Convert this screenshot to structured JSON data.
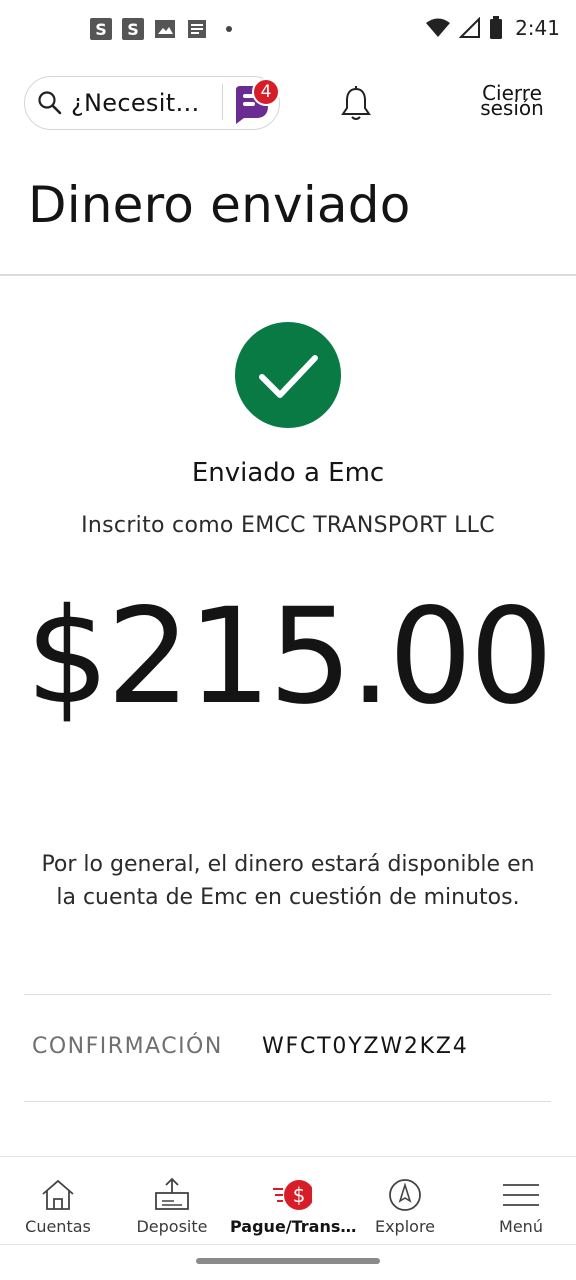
{
  "status_bar": {
    "notif_icon_1": "S",
    "notif_icon_2": "S",
    "time": "2:41",
    "icons": [
      "image-icon",
      "note-icon",
      "wifi-icon",
      "signal-icon",
      "battery-icon"
    ]
  },
  "header": {
    "search_placeholder": "¿Necesit…",
    "fargo_badge_count": "4",
    "logout_line1": "Cierre",
    "logout_line2": "sesión"
  },
  "page": {
    "title": "Dinero enviado"
  },
  "confirmation": {
    "sent_to": "Enviado a Emc",
    "enrolled_as": "Inscrito como EMCC TRANSPORT LLC",
    "amount": "$215.00",
    "info_text": "Por lo general, el dinero estará disponible en la cuenta de Emc en cuestión de minutos.",
    "confirmation_label": "CONFIRMACIÓN",
    "confirmation_number": "WFCT0YZW2KZ4"
  },
  "bottom_nav": {
    "items": [
      {
        "label": "Cuentas",
        "icon": "home-icon"
      },
      {
        "label": "Deposite",
        "icon": "deposit-icon"
      },
      {
        "label": "Pague/Trans…",
        "icon": "pay-transfer-icon"
      },
      {
        "label": "Explore",
        "icon": "compass-icon"
      },
      {
        "label": "Menú",
        "icon": "hamburger-menu-icon"
      }
    ],
    "active_index": 2
  },
  "colors": {
    "success_green": "#0a7a45",
    "brand_red": "#d71e28",
    "fargo_purple": "#6b2c91",
    "text_dark": "#141414",
    "divider": "#dcdcdc"
  }
}
